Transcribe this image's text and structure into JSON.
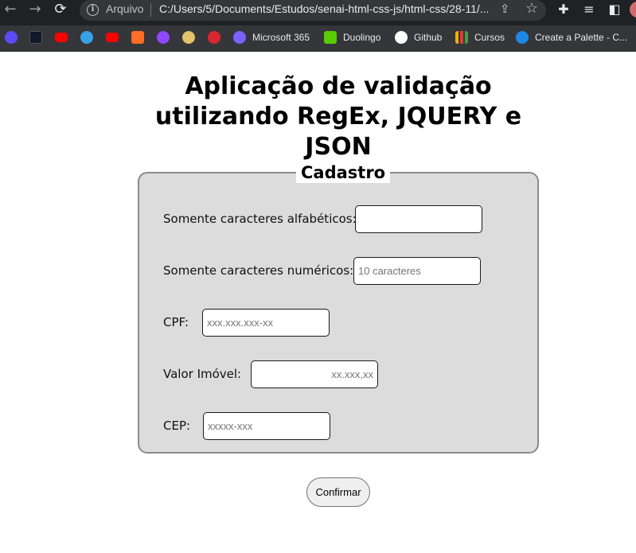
{
  "browser": {
    "nav": {
      "back": "←",
      "forward": "→",
      "reload": "⟳"
    },
    "address_bar": {
      "security_label": "Arquivo",
      "url": "C:/Users/5/Documents/Estudos/senai-html-css-js/html-css/28-11/..."
    },
    "bookmarks": [
      {
        "label": "",
        "icon": "bookmark-app-icon",
        "color": "#5b4cf5"
      },
      {
        "label": "",
        "icon": "amazon-icon",
        "color": "#111827"
      },
      {
        "label": "",
        "icon": "youtube-icon",
        "color": "#ff0000"
      },
      {
        "label": "",
        "icon": "app-icon",
        "color": "#3aa0e8"
      },
      {
        "label": "",
        "icon": "youtube-icon",
        "color": "#ff0000"
      },
      {
        "label": "",
        "icon": "gitlab-icon",
        "color": "#fc6d26"
      },
      {
        "label": "",
        "icon": "twitch-icon",
        "color": "#9146ff"
      },
      {
        "label": "",
        "icon": "onepiece-icon",
        "color": "#e0c36a"
      },
      {
        "label": "",
        "icon": "mega-icon",
        "color": "#d9272e"
      },
      {
        "label": "Microsoft 365",
        "icon": "microsoft365-icon",
        "color": "#7b61ff"
      },
      {
        "label": "Duolingo",
        "icon": "duolingo-icon",
        "color": "#58cc02"
      },
      {
        "label": "Github",
        "icon": "github-icon",
        "color": "#ffffff"
      },
      {
        "label": "Cursos",
        "icon": "chart-icon",
        "color": "#f2b200"
      },
      {
        "label": "Create a Palette - C...",
        "icon": "palette-icon",
        "color": "#1e88e5"
      }
    ]
  },
  "page": {
    "title": "Aplicação de validação utilizando RegEx, JQUERY e JSON",
    "form": {
      "legend": "Cadastro",
      "fields": [
        {
          "label": "Somente caracteres alfabéticos:",
          "placeholder": ""
        },
        {
          "label": "Somente caracteres numéricos:",
          "placeholder": "10 caracteres"
        },
        {
          "label": "CPF:",
          "placeholder": "xxx.xxx.xxx-xx"
        },
        {
          "label": "Valor Imóvel:",
          "placeholder": "xx.xxx,xx"
        },
        {
          "label": "CEP:",
          "placeholder": "xxxxx-xxx"
        }
      ]
    },
    "confirm_label": "Confirmar"
  }
}
